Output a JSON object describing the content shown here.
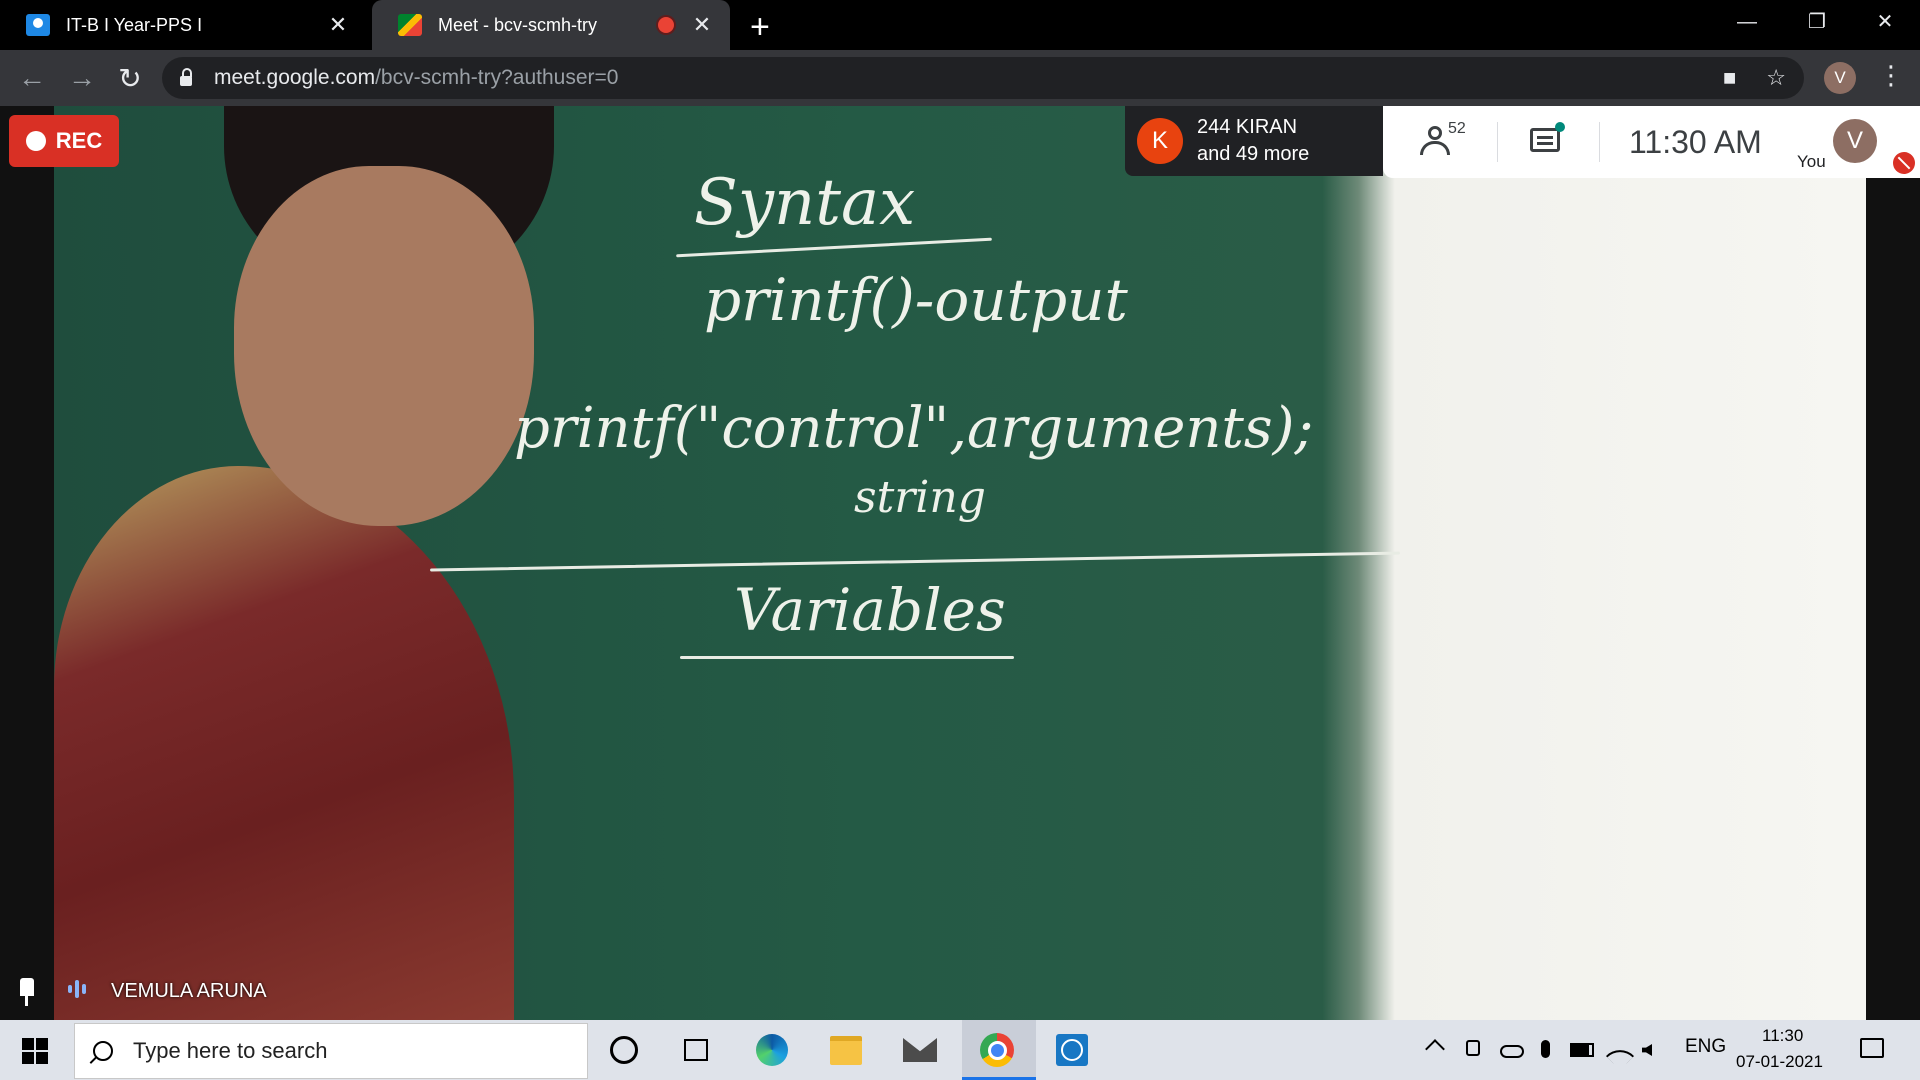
{
  "browser": {
    "tabs": [
      {
        "title": "IT-B I Year-PPS I",
        "favicon": "classroom-icon",
        "active": false
      },
      {
        "title": "Meet - bcv-scmh-try",
        "favicon": "meet-icon",
        "active": true,
        "recording": true
      }
    ],
    "url_host": "meet.google.com",
    "url_path": "/bcv-scmh-try?authuser=0",
    "profile_initial": "V"
  },
  "meet": {
    "rec_label": "REC",
    "presenter_initial": "K",
    "presenter_line1": "244 KIRAN",
    "presenter_line2": "and 49 more",
    "people_count": "52",
    "time": "11:30  AM",
    "self_initial": "V",
    "self_label": "You",
    "speaker_name": "VEMULA ARUNA"
  },
  "board": {
    "line1": "Syntax",
    "line2": "printf()-output",
    "line3": "printf(\"control\",arguments);",
    "line4": "string",
    "line5": "Variables"
  },
  "taskbar": {
    "search_placeholder": "Type here to search",
    "language": "ENG",
    "clock_time": "11:30",
    "clock_date": "07-01-2021"
  },
  "colors": {
    "rec": "#d93025",
    "presenter_avatar": "#e8430f",
    "self_avatar": "#8d6e63",
    "board": "#245a45"
  }
}
